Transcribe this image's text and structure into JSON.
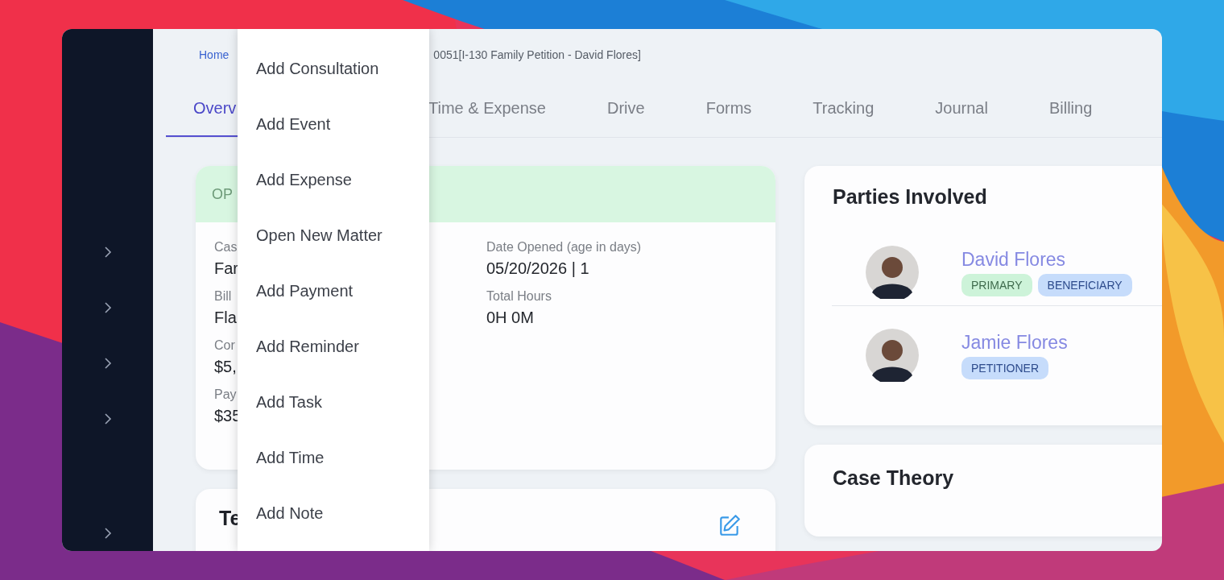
{
  "sidebar": {
    "items": [
      {
        "kind": "expander"
      },
      {
        "kind": "expander"
      },
      {
        "kind": "expander"
      },
      {
        "kind": "expander"
      },
      {
        "kind": "expander"
      }
    ]
  },
  "breadcrumb": [
    {
      "text": "Home",
      "kind": "link"
    },
    {
      "text": "0051[I-130 Family Petition - David Flores]",
      "kind": "current"
    }
  ],
  "tabs": [
    {
      "label": "Overv",
      "selected": true
    },
    {
      "label": "Time & Expense",
      "selected": false
    },
    {
      "label": "Drive",
      "selected": false
    },
    {
      "label": "Forms",
      "selected": false
    },
    {
      "label": "Tracking",
      "selected": false
    },
    {
      "label": "Journal",
      "selected": false
    },
    {
      "label": "Billing",
      "selected": false
    }
  ],
  "status_card": {
    "status": "OP",
    "fields_left": [
      {
        "label": "Cas",
        "value": "Far"
      },
      {
        "label": "Bill",
        "value": "Fla"
      },
      {
        "label": "Cor",
        "value": "$5,"
      },
      {
        "label": "Pay",
        "value": "$35"
      }
    ],
    "fields_right": [
      {
        "label": "Date Opened (age in days)",
        "value": "05/20/2026 | 1"
      },
      {
        "label": "Total Hours",
        "value": "0H 0M"
      }
    ]
  },
  "notes_card": {
    "title": "Te"
  },
  "menu": {
    "items": [
      "Add Consultation",
      "Add Event",
      "Add Expense",
      "Open New Matter",
      "Add Payment",
      "Add Reminder",
      "Add Task",
      "Add Time",
      "Add Note"
    ]
  },
  "parties": {
    "title": "Parties Involved",
    "people": [
      {
        "name": "David Flores",
        "tags": [
          {
            "text": "PRIMARY",
            "color": "#cdf3d9"
          },
          {
            "text": "BENEFICIARY",
            "color": "#c6dcfb"
          }
        ]
      },
      {
        "name": "Jamie Flores",
        "tags": [
          {
            "text": "PETITIONER",
            "color": "#c6dcfb"
          }
        ]
      }
    ]
  },
  "case_theory": {
    "title": "Case Theory"
  }
}
